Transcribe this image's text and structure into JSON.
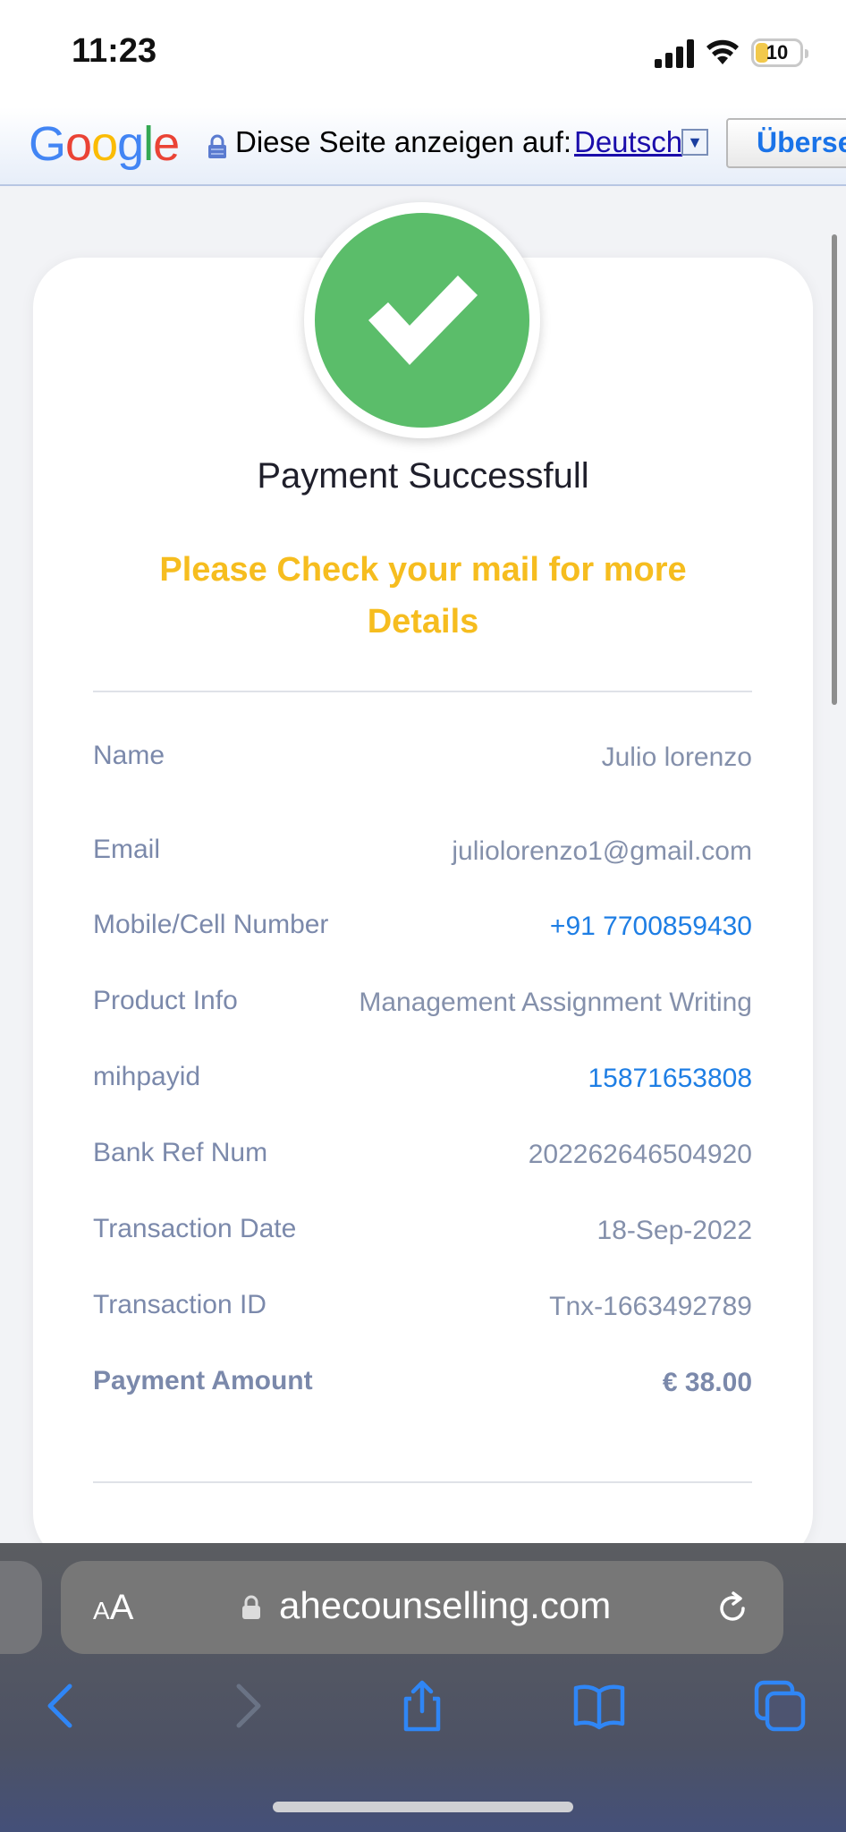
{
  "status_bar": {
    "time": "11:23",
    "battery": "10"
  },
  "translate_bar": {
    "logo": [
      "G",
      "o",
      "o",
      "g",
      "l",
      "e"
    ],
    "prompt": "Diese Seite anzeigen auf:",
    "language": "Deutsch",
    "translate_button": "Überse"
  },
  "payment": {
    "title": "Payment Successfull",
    "subtitle": "Please Check your mail for more Details",
    "rows": [
      {
        "label": "Name",
        "value": "Julio lorenzo"
      },
      {
        "label": "Email",
        "value": "juliolorenzo1@gmail.com"
      },
      {
        "label": "Mobile/Cell Number",
        "value": "+91 7700859430"
      },
      {
        "label": "Product Info",
        "value": "Management Assignment Writing"
      },
      {
        "label": "mihpayid",
        "value": "15871653808"
      },
      {
        "label": "Bank Ref Num",
        "value": "202262646504920"
      },
      {
        "label": "Transaction Date",
        "value": "18-Sep-2022"
      },
      {
        "label": "Transaction ID",
        "value": "Tnx-1663492789"
      },
      {
        "label": "Payment Amount",
        "value": "€ 38.00"
      }
    ]
  },
  "browser": {
    "text_size_label": "AA",
    "url": "ahecounselling.com",
    "icons": [
      "back-icon",
      "forward-icon",
      "share-icon",
      "bookmarks-icon",
      "tabs-icon"
    ]
  },
  "colors": {
    "success_green": "#5bbd6a",
    "accent_yellow": "#f6bd1f",
    "link_blue": "#1e7ee4",
    "label_gray": "#7b89ab"
  }
}
